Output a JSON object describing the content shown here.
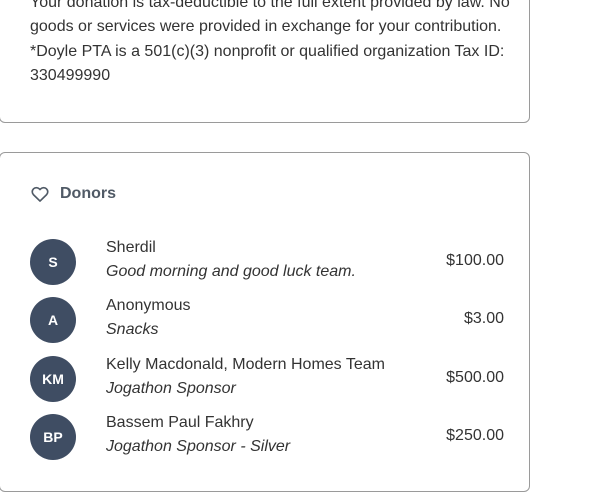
{
  "tax_notice": {
    "text": "Your donation is tax-deductible to the full extent provided by law. No goods or services were provided in exchange for your contribution. *Doyle PTA is a 501(c)(3) nonprofit or qualified organization Tax ID: 330499990"
  },
  "donors": {
    "title": "Donors",
    "icon": "heart-icon",
    "avatar_color": "#3f4d63",
    "items": [
      {
        "initials": "S",
        "name": "Sherdil",
        "note": "Good morning and good luck team.",
        "amount": "$100.00"
      },
      {
        "initials": "A",
        "name": "Anonymous",
        "note": "Snacks",
        "amount": "$3.00"
      },
      {
        "initials": "KM",
        "name": "Kelly Macdonald, Modern Homes Team",
        "note": "Jogathon Sponsor",
        "amount": "$500.00"
      },
      {
        "initials": "BP",
        "name": "Bassem Paul Fakhry",
        "note": "Jogathon Sponsor - Silver",
        "amount": "$250.00"
      }
    ]
  }
}
